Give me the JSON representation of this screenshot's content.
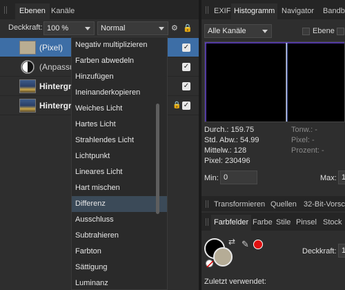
{
  "layers_panel": {
    "tabs": [
      "Ebenen",
      "Kanäle"
    ],
    "opacity_label": "Deckkraft:",
    "opacity_value": "100 %",
    "blend_mode": "Normal",
    "layers": [
      {
        "name": "(Pixel)",
        "selected": true,
        "visible": true,
        "locked": false
      },
      {
        "name": "(Anpassu",
        "selected": false,
        "visible": true,
        "locked": false
      },
      {
        "name": "Hintergr",
        "selected": false,
        "visible": true,
        "locked": false
      },
      {
        "name": "Hintergr",
        "selected": false,
        "visible": true,
        "locked": true
      }
    ]
  },
  "blend_menu": {
    "items": [
      "Negativ multiplizieren",
      "Farben abwedeln",
      "Hinzufügen",
      "Ineinanderkopieren",
      "Weiches Licht",
      "Hartes Licht",
      "Strahlendes Licht",
      "Lichtpunkt",
      "Lineares Licht",
      "Hart mischen",
      "Differenz",
      "Ausschluss",
      "Subtrahieren",
      "Farbton",
      "Sättigung",
      "Luminanz"
    ],
    "highlighted": "Differenz"
  },
  "right_panel": {
    "tabs": [
      "EXIF",
      "Histogramm",
      "Navigator",
      "Bandbi"
    ],
    "channel_select": "Alle Kanäle",
    "ebene_label": "Ebene",
    "stats": {
      "durch": "Durch.: 159.75",
      "std": "Std. Abw.: 54.99",
      "mittel": "Mittelw.: 128",
      "pixel": "Pixel: 230496",
      "tonw": "Tonw.: -",
      "pixel2": "Pixel: -",
      "prozent": "Prozent: -"
    },
    "min_label": "Min:",
    "min_value": "0",
    "max_label": "Max:",
    "max_value": "1",
    "tools_tabs": [
      "Transformieren",
      "Quellen",
      "32-Bit-Vorsc"
    ],
    "color_tabs": [
      "Farbfelder",
      "Farbe",
      "Stile",
      "Pinsel",
      "Stock"
    ],
    "deckkraft_label": "Deckkraft:",
    "deckkraft_value": "1",
    "recent_label": "Zuletzt verwendet:"
  },
  "colors": {
    "selection": "#3d6ea6",
    "menu_highlight": "#3b4a58",
    "histogram_line": "#6b4bd8",
    "red_swatch": "#e01010"
  }
}
